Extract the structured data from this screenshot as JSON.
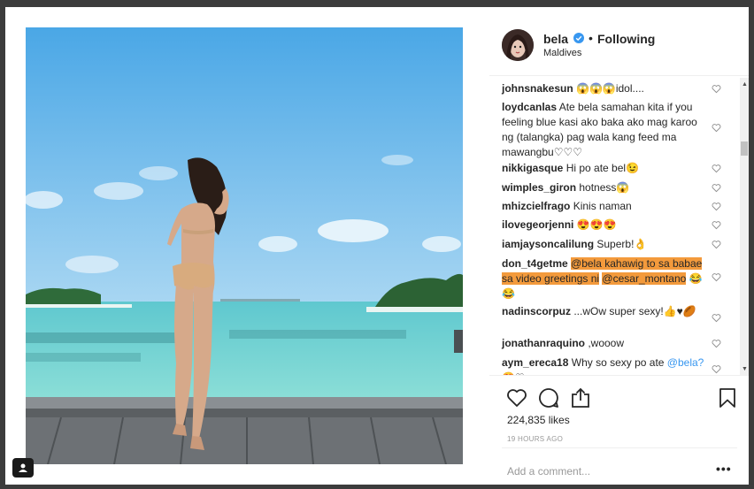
{
  "post": {
    "username": "bela",
    "follow_status": "Following",
    "separator": "•",
    "location": "Maldives",
    "likes": "224,835 likes",
    "time": "19 HOURS AGO",
    "add_comment_placeholder": "Add a comment...",
    "more_options": "•••"
  },
  "comments": [
    {
      "user": "johnsnakesun",
      "text": " 😱😱😱idol...."
    },
    {
      "user": "loydcanlas",
      "text": " Ate bela samahan kita if you feeling blue kasi ako baka ako mag karoo ng (talangka) pag wala kang feed ma mawangbu♡♡♡"
    },
    {
      "user": "nikkigasque",
      "text": " Hi po ate bel😉"
    },
    {
      "user": "wimples_giron",
      "text": " hotness😱"
    },
    {
      "user": "mhizcielfrago",
      "text": " Kinis naman"
    },
    {
      "user": "ilovegeorjenni",
      "text": " 😍😍😍"
    },
    {
      "user": "iamjaysoncalilung",
      "text": " Superb!👌"
    },
    {
      "user": "don_t4getme",
      "mention1": "@bela",
      "text_hl": " kahawig to sa babae sa video greetings ni",
      "mention2": "@cesar_montano",
      "text_after": " 😂😂"
    },
    {
      "user": "nadinscorpuz",
      "text": " ...wOw super sexy!👍♥🏉"
    },
    {
      "user": "jonathanraquino",
      "text": " ,wooow"
    },
    {
      "user": "aym_ereca18",
      "text": " Why so sexy po ate",
      "mention": "@bela?",
      "text_after": " 😍♡"
    }
  ],
  "colors": {
    "highlight": "#f39a3c",
    "verified": "#3897f0",
    "muted": "#999999",
    "text": "#262626"
  },
  "icons": [
    "heart-icon",
    "comment-icon",
    "share-icon",
    "bookmark-icon",
    "user-tag-icon",
    "verified-badge-icon"
  ]
}
